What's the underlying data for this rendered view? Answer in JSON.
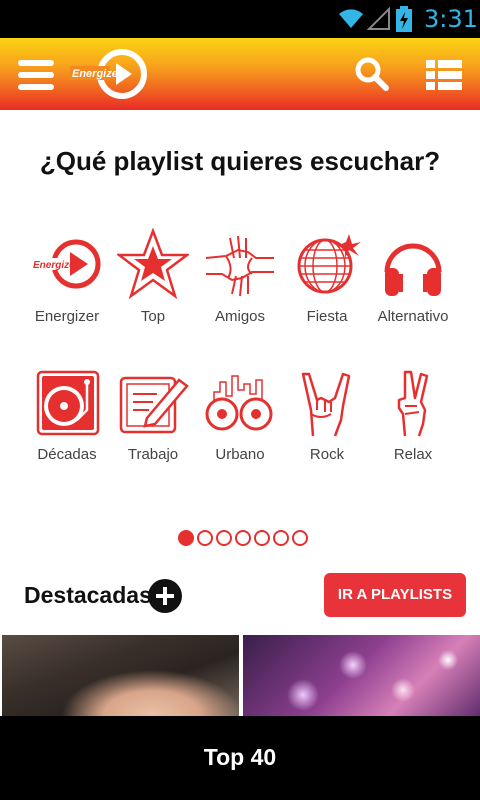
{
  "status_bar": {
    "time": "3:31",
    "wifi_icon": "wifi-icon",
    "signal_icon": "signal-icon",
    "battery_icon": "battery-charging-icon",
    "time_color": "#33b5e5"
  },
  "header": {
    "menu_icon": "hamburger-menu-icon",
    "logo_text": "Energizer",
    "search_icon": "search-icon",
    "list_icon": "list-view-icon",
    "gradient_colors": [
      "#fbd412",
      "#f05e21",
      "#e82a26"
    ]
  },
  "heading": "¿Qué playlist quieres escuchar?",
  "categories": [
    {
      "label": "Energizer",
      "icon": "energizer-logo-icon"
    },
    {
      "label": "Top",
      "icon": "star-icon"
    },
    {
      "label": "Amigos",
      "icon": "handshake-icon"
    },
    {
      "label": "Fiesta",
      "icon": "disco-ball-icon"
    },
    {
      "label": "Alternativo",
      "icon": "headphones-icon"
    },
    {
      "label": "Décadas",
      "icon": "turntable-icon"
    },
    {
      "label": "Trabajo",
      "icon": "document-pencil-icon"
    },
    {
      "label": "Urbano",
      "icon": "city-speakers-icon"
    },
    {
      "label": "Rock",
      "icon": "rock-hand-icon"
    },
    {
      "label": "Relax",
      "icon": "peace-hand-icon"
    }
  ],
  "pager": {
    "count": 7,
    "active": 0
  },
  "featured": {
    "title": "Destacadas",
    "add_icon": "plus-circle-icon",
    "button_label": "IR A PLAYLISTS"
  },
  "now_playing": {
    "title": "Top 40"
  },
  "accent_color": "#e8333a"
}
